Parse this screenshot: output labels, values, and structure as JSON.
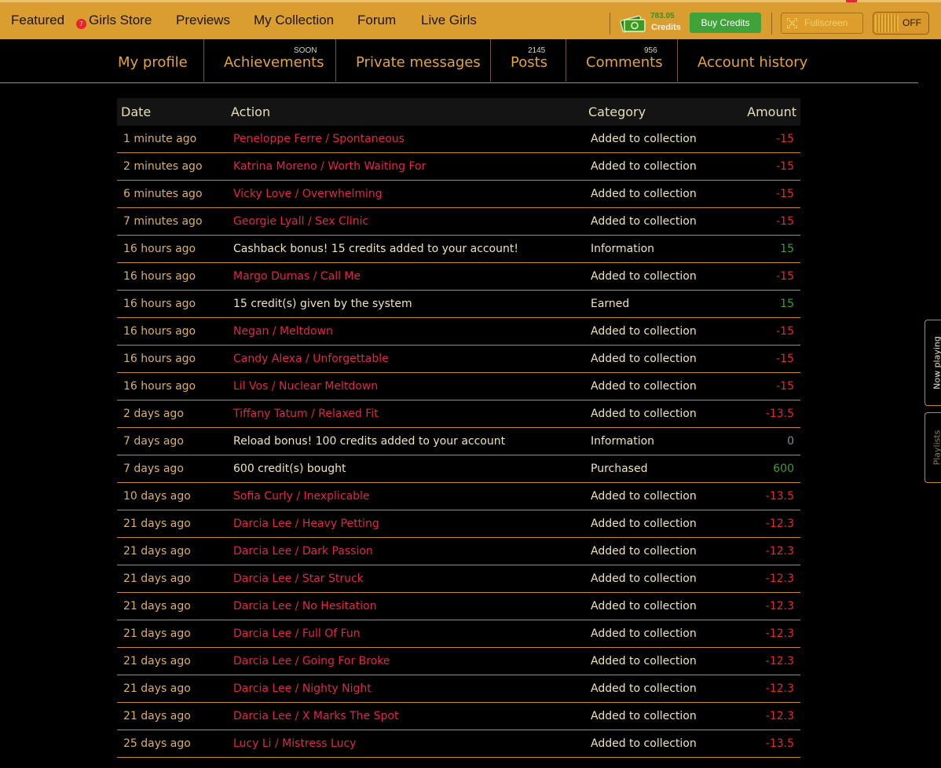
{
  "nav": {
    "items": [
      "Featured",
      "Girls Store",
      "Previews",
      "My Collection",
      "Forum",
      "Live Girls"
    ],
    "featured_badge": "7"
  },
  "credits": {
    "amount": "783.05",
    "label": "Credits"
  },
  "buttons": {
    "buy": "Buy Credits",
    "fullscreen": "Fullscreen",
    "toggle": "OFF"
  },
  "subtabs": {
    "my_profile": "My profile",
    "achievements": "Achievements",
    "achievements_note": "SOON",
    "private_messages": "Private messages",
    "posts": "Posts",
    "posts_count": "2145",
    "comments": "Comments",
    "comments_count": "956",
    "account_history": "Account history"
  },
  "table": {
    "headers": {
      "date": "Date",
      "action": "Action",
      "category": "Category",
      "amount": "Amount"
    },
    "rows": [
      {
        "date": "1 minute ago",
        "action": "Peneloppe Ferre / Spontaneous",
        "category": "Added to collection",
        "amount": "-15",
        "kind": "link",
        "sign": "neg"
      },
      {
        "date": "2 minutes ago",
        "action": "Katrina Moreno / Worth Waiting For",
        "category": "Added to collection",
        "amount": "-15",
        "kind": "link",
        "sign": "neg"
      },
      {
        "date": "6 minutes ago",
        "action": "Vicky Love / Overwhelming",
        "category": "Added to collection",
        "amount": "-15",
        "kind": "link",
        "sign": "neg"
      },
      {
        "date": "7 minutes ago",
        "action": "Georgie Lyall / Sex Clinic",
        "category": "Added to collection",
        "amount": "-15",
        "kind": "link",
        "sign": "neg"
      },
      {
        "date": "16 hours ago",
        "action": "Cashback bonus! 15 credits added to your account!",
        "category": "Information",
        "amount": "15",
        "kind": "plain",
        "sign": "pos"
      },
      {
        "date": "16 hours ago",
        "action": "Margo Dumas / Call Me",
        "category": "Added to collection",
        "amount": "-15",
        "kind": "link",
        "sign": "neg"
      },
      {
        "date": "16 hours ago",
        "action": "15 credit(s) given by the system",
        "category": "Earned",
        "amount": "15",
        "kind": "plain",
        "sign": "pos"
      },
      {
        "date": "16 hours ago",
        "action": "Negan / Meltdown",
        "category": "Added to collection",
        "amount": "-15",
        "kind": "link",
        "sign": "neg"
      },
      {
        "date": "16 hours ago",
        "action": "Candy Alexa / Unforgettable",
        "category": "Added to collection",
        "amount": "-15",
        "kind": "link",
        "sign": "neg"
      },
      {
        "date": "16 hours ago",
        "action": "Lil Vos / Nuclear Meltdown",
        "category": "Added to collection",
        "amount": "-15",
        "kind": "link",
        "sign": "neg"
      },
      {
        "date": "2 days ago",
        "action": "Tiffany Tatum / Relaxed Fit",
        "category": "Added to collection",
        "amount": "-13.5",
        "kind": "link",
        "sign": "neg"
      },
      {
        "date": "7 days ago",
        "action": "Reload bonus! 100 credits added to your account",
        "category": "Information",
        "amount": "0",
        "kind": "plain",
        "sign": "zero"
      },
      {
        "date": "7 days ago",
        "action": "600 credit(s) bought",
        "category": "Purchased",
        "amount": "600",
        "kind": "plain",
        "sign": "pos"
      },
      {
        "date": "10 days ago",
        "action": "Sofia Curly / Inexplicable",
        "category": "Added to collection",
        "amount": "-13.5",
        "kind": "link",
        "sign": "neg"
      },
      {
        "date": "21 days ago",
        "action": "Darcia Lee / Heavy Petting",
        "category": "Added to collection",
        "amount": "-12.3",
        "kind": "link",
        "sign": "neg"
      },
      {
        "date": "21 days ago",
        "action": "Darcia Lee / Dark Passion",
        "category": "Added to collection",
        "amount": "-12.3",
        "kind": "link",
        "sign": "neg"
      },
      {
        "date": "21 days ago",
        "action": "Darcia Lee / Star Struck",
        "category": "Added to collection",
        "amount": "-12.3",
        "kind": "link",
        "sign": "neg"
      },
      {
        "date": "21 days ago",
        "action": "Darcia Lee / No Hesitation",
        "category": "Added to collection",
        "amount": "-12.3",
        "kind": "link",
        "sign": "neg"
      },
      {
        "date": "21 days ago",
        "action": "Darcia Lee / Full Of Fun",
        "category": "Added to collection",
        "amount": "-12.3",
        "kind": "link",
        "sign": "neg"
      },
      {
        "date": "21 days ago",
        "action": "Darcia Lee / Going For Broke",
        "category": "Added to collection",
        "amount": "-12.3",
        "kind": "link",
        "sign": "neg"
      },
      {
        "date": "21 days ago",
        "action": "Darcia Lee / Nighty Night",
        "category": "Added to collection",
        "amount": "-12.3",
        "kind": "link",
        "sign": "neg"
      },
      {
        "date": "21 days ago",
        "action": "Darcia Lee / X Marks The Spot",
        "category": "Added to collection",
        "amount": "-12.3",
        "kind": "link",
        "sign": "neg"
      },
      {
        "date": "25 days ago",
        "action": "Lucy Li / Mistress Lucy",
        "category": "Added to collection",
        "amount": "-13.5",
        "kind": "link",
        "sign": "neg"
      }
    ]
  },
  "side_tabs": {
    "now_playing": "Now playing",
    "playlists": "Playlists"
  }
}
